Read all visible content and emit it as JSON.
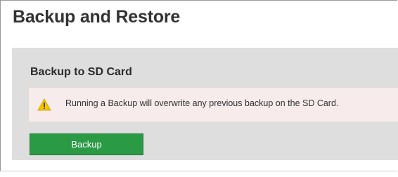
{
  "page": {
    "title": "Backup and Restore"
  },
  "backup_section": {
    "title": "Backup to SD Card",
    "warning": {
      "icon": "warning-triangle-icon",
      "text": "Running a Backup will overwrite any previous backup on the SD Card.",
      "background_color": "#f7ebeb",
      "icon_color": "#f5c400"
    },
    "button": {
      "label": "Backup",
      "color": "#2b9a45"
    }
  }
}
